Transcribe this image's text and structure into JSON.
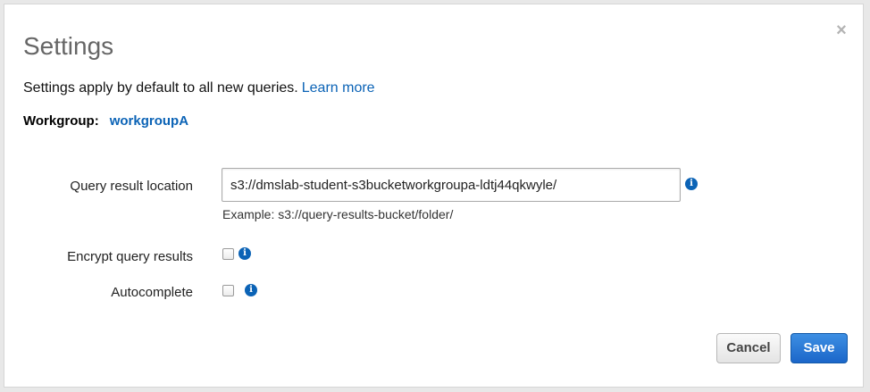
{
  "dialog": {
    "title": "Settings",
    "close_symbol": "×",
    "subtitle": "Settings apply by default to all new queries.",
    "learn_more": "Learn more",
    "workgroup_label": "Workgroup:",
    "workgroup_value": "workgroupA"
  },
  "form": {
    "query_result_location": {
      "label": "Query result location",
      "value": "s3://dmslab-student-s3bucketworkgroupa-ldtj44qkwyle/",
      "hint": "Example: s3://query-results-bucket/folder/",
      "info_icon": "info-icon"
    },
    "encrypt_query_results": {
      "label": "Encrypt query results",
      "checked": false,
      "info_icon": "info-icon"
    },
    "autocomplete": {
      "label": "Autocomplete",
      "checked": false,
      "info_icon": "info-icon"
    }
  },
  "buttons": {
    "cancel": "Cancel",
    "save": "Save"
  },
  "colors": {
    "link": "#0b63b6",
    "primary_button": "#1b66c9",
    "title": "#666666"
  }
}
